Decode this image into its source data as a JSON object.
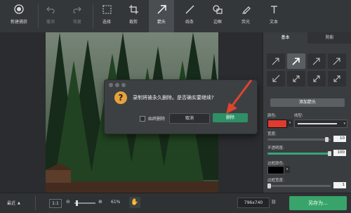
{
  "toolbar": {
    "new_capture": "新建捕获",
    "undo": "撤消",
    "redo": "恢复",
    "select": "选择",
    "crop": "裁剪",
    "arrow": "箭头",
    "line": "线条",
    "border": "边框",
    "highlight": "荧光",
    "text": "文本"
  },
  "dialog": {
    "message": "录制将被永久删除。是否确实要继续?",
    "checkbox_label": "始终删除",
    "cancel": "取消",
    "delete": "删除"
  },
  "panel": {
    "tabs": [
      "基本",
      "阴影"
    ],
    "add_arrow": "添加箭头",
    "color_label": "颜色:",
    "line_type_label": "线型:",
    "width_label": "宽度:",
    "width_value": "10",
    "opacity_label": "不透明度:",
    "opacity_value": "100",
    "border_color_label": "边框颜色:",
    "border_width_label": "边框宽度:",
    "border_width_value": "1"
  },
  "bottom": {
    "recent": "最近",
    "ratio": "1:1",
    "zoom": "61%",
    "size": "796x740",
    "save_as": "另存为..."
  },
  "colors": {
    "accent": "#38a46a",
    "arrow_color": "#e03b2e"
  }
}
